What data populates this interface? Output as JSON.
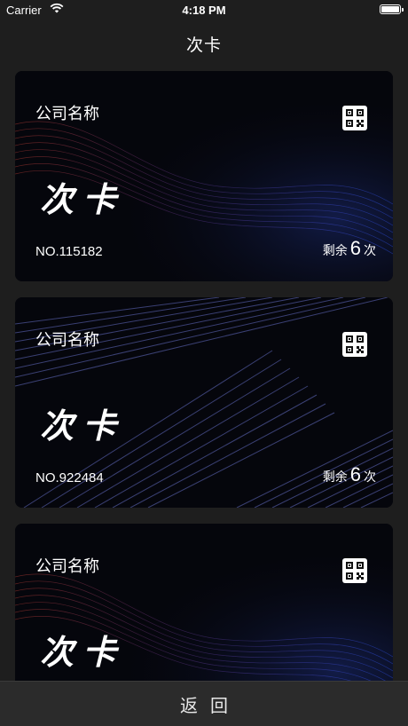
{
  "status_bar": {
    "carrier": "Carrier",
    "time": "4:18 PM"
  },
  "nav": {
    "title": "次卡"
  },
  "cards": [
    {
      "company": "公司名称",
      "title": "次卡",
      "number": "NO.115182",
      "remain_prefix": "剩余",
      "remain_count": "6",
      "remain_suffix": "次",
      "style": "wave"
    },
    {
      "company": "公司名称",
      "title": "次卡",
      "number": "NO.922484",
      "remain_prefix": "剩余",
      "remain_count": "6",
      "remain_suffix": "次",
      "style": "stripes"
    },
    {
      "company": "公司名称",
      "title": "次卡",
      "number": "",
      "remain_prefix": "",
      "remain_count": "",
      "remain_suffix": "",
      "style": "wave"
    }
  ],
  "footer": {
    "back_label": "返回"
  },
  "icons": {
    "qr": "qr-code-icon",
    "wifi": "wifi-icon",
    "battery": "battery-icon"
  },
  "colors": {
    "background": "#1e1e1e",
    "card": "#05060c",
    "accent_blue": "#2a4bd8",
    "accent_red": "#b0392f"
  }
}
